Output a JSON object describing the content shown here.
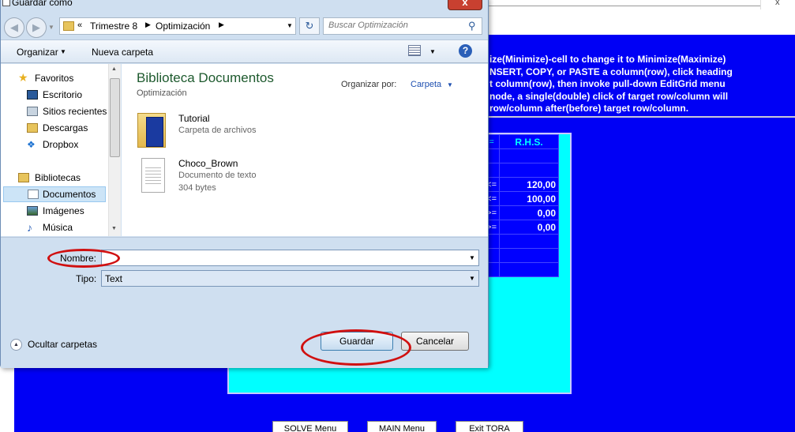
{
  "background_app": {
    "close_glyph": "x",
    "instructions": [
      "ize(Minimize)-cell to change it to Minimize(Maximize)",
      "NSERT, COPY, or PASTE a column(row), click heading",
      "t column(row), then invoke pull-down EditGrid menu",
      "node, a single(double) click of target row/column will",
      "row/column after(before) target row/column."
    ],
    "grid": {
      "header_op": "=",
      "header_rhs": "R.H.S.",
      "rows": [
        {
          "op": "",
          "rhs": ""
        },
        {
          "op": "",
          "rhs": ""
        },
        {
          "op": "<=",
          "rhs": "120,00"
        },
        {
          "op": "<=",
          "rhs": "100,00"
        },
        {
          "op": ">=",
          "rhs": "0,00"
        },
        {
          "op": ">=",
          "rhs": "0,00"
        },
        {
          "op": "",
          "rhs": ""
        },
        {
          "op": "",
          "rhs": ""
        },
        {
          "op": "",
          "rhs": ""
        }
      ]
    },
    "buttons": {
      "solve": "SOLVE Menu",
      "main": "MAIN Menu",
      "exit": "Exit TORA"
    }
  },
  "dialog": {
    "title": "Guardar como",
    "close_glyph": "x",
    "nav": {
      "back_icon": "arrow-left",
      "forward_icon": "arrow-right",
      "breadcrumb_prefix": "«",
      "breadcrumb": [
        "Trimestre 8",
        "Optimización"
      ],
      "refresh_icon": "refresh",
      "search_placeholder": "Buscar Optimización"
    },
    "toolbar": {
      "organize": "Organizar",
      "new_folder": "Nueva carpeta",
      "help": "?"
    },
    "sidebar": {
      "items": [
        {
          "label": "Favoritos",
          "icon": "star-icon",
          "top": 0
        },
        {
          "label": "Escritorio",
          "icon": "desktop-icon"
        },
        {
          "label": "Sitios recientes",
          "icon": "recent-places-icon"
        },
        {
          "label": "Descargas",
          "icon": "downloads-icon"
        },
        {
          "label": "Dropbox",
          "icon": "dropbox-icon"
        },
        {
          "label": "Bibliotecas",
          "icon": "libraries-icon"
        },
        {
          "label": "Documentos",
          "icon": "documents-icon",
          "selected": true
        },
        {
          "label": "Imágenes",
          "icon": "pictures-icon"
        },
        {
          "label": "Música",
          "icon": "music-icon"
        }
      ]
    },
    "content": {
      "library_title": "Biblioteca Documentos",
      "library_subtitle": "Optimización",
      "arrange_label": "Organizar por:",
      "arrange_value": "Carpeta",
      "files": [
        {
          "name": "Tutorial",
          "type": "Carpeta de archivos",
          "size": ""
        },
        {
          "name": "Choco_Brown",
          "type": "Documento de texto",
          "size": "304 bytes"
        }
      ]
    },
    "form": {
      "name_label": "Nombre:",
      "name_value": "",
      "type_label": "Tipo:",
      "type_value": "Text",
      "hide_folders": "Ocultar carpetas",
      "save": "Guardar",
      "cancel": "Cancelar"
    }
  },
  "colors": {
    "app_blue": "#0000f5",
    "grid_cyan": "#00ffff",
    "annotation_red": "#d01010",
    "library_title_green": "#1e5a2e"
  }
}
